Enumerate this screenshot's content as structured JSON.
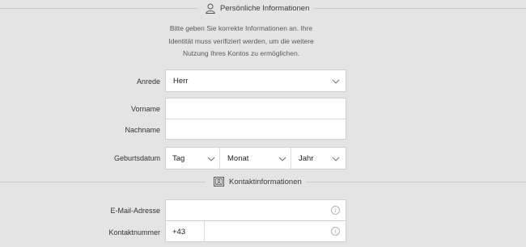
{
  "sections": {
    "personal": {
      "title": "Persönliche Informationen",
      "icon": "person-icon"
    },
    "contact": {
      "title": "Kontaktinformationen",
      "icon": "contact-card-icon"
    }
  },
  "intro": {
    "line1": "Bitte geben Sie korrekte Informationen an. Ihre",
    "line2": "Identität muss verifiziert werden, um die weitere",
    "line3": "Nutzung Ihres Kontos zu ermöglichen."
  },
  "form": {
    "salutation": {
      "label": "Anrede",
      "value": "Herr"
    },
    "first_name": {
      "label": "Vorname",
      "value": ""
    },
    "last_name": {
      "label": "Nachname",
      "value": ""
    },
    "birthdate": {
      "label": "Geburtsdatum",
      "day": "Tag",
      "month": "Monat",
      "year": "Jahr"
    },
    "email": {
      "label": "E-Mail-Adresse",
      "value": ""
    },
    "phone": {
      "label": "Kontaktnummer",
      "country_code": "+43",
      "value": ""
    }
  },
  "colors": {
    "background": "#e4e4e4",
    "field": "#ffffff",
    "border": "#cfcfcf"
  }
}
